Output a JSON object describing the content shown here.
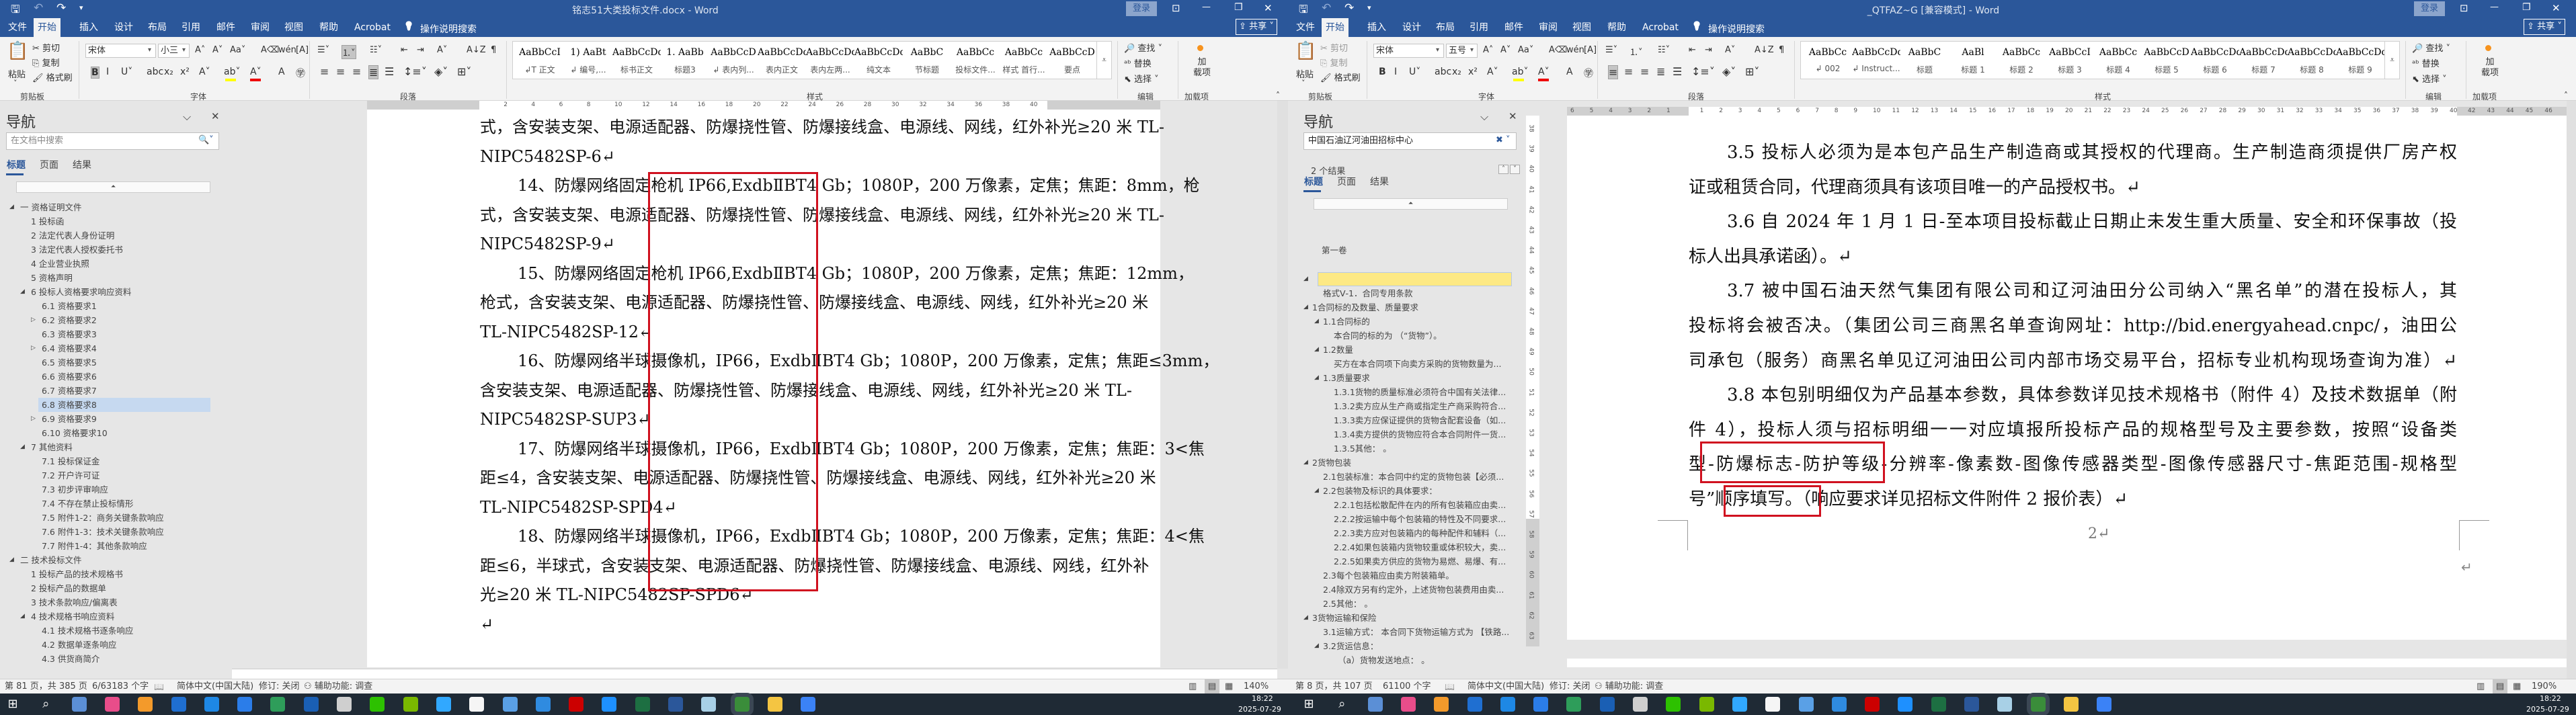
{
  "windows": [
    {
      "id": "left",
      "title": "铭志51大类投标文件.docx - Word",
      "login": "登录",
      "share": "共享",
      "tabs": [
        "文件",
        "开始",
        "插入",
        "设计",
        "布局",
        "引用",
        "邮件",
        "审阅",
        "视图",
        "帮助",
        "Acrobat"
      ],
      "active_tab": 1,
      "tell_me": "操作说明搜索",
      "clipboard": {
        "paste": "粘贴",
        "cut": "剪切",
        "copy": "复制",
        "format_painter": "格式刷",
        "group": "剪贴板",
        "cut_disabled": false
      },
      "font": {
        "name": "宋体",
        "size": "小三",
        "group": "字体"
      },
      "paragraph": {
        "group": "段落"
      },
      "styles": {
        "group": "样式",
        "items": [
          {
            "preview": "AaBbCcI",
            "label": "↲T 正文"
          },
          {
            "preview": "1) AaBt",
            "label": "↲ 编号,..."
          },
          {
            "preview": "AaBbCcDdI",
            "label": "标书正文"
          },
          {
            "preview": "1. AaBb",
            "label": "标题3"
          },
          {
            "preview": "AaBbCcD",
            "label": "↲ 表内列..."
          },
          {
            "preview": "AaBbCcDdI",
            "label": "表内正文"
          },
          {
            "preview": "AaBbCcDdEe",
            "label": "表内左两..."
          },
          {
            "preview": "AaBbCcDdI",
            "label": "纯文本"
          },
          {
            "preview": "AaBbC",
            "label": "节标题"
          },
          {
            "preview": "AaBbCc",
            "label": "投标文件..."
          },
          {
            "preview": "AaBbCc",
            "label": "样式 首行..."
          },
          {
            "preview": "AaBbCcD",
            "label": "要点"
          }
        ]
      },
      "editing": {
        "find": "查找",
        "replace": "替换",
        "select": "选择",
        "group": "编辑"
      },
      "addins": {
        "label": "加载项",
        "button": "加\n载项"
      },
      "nav": {
        "title": "导航",
        "search_placeholder": "在文档中搜索",
        "search_value": "",
        "results": "",
        "tabs": [
          "标题",
          "页面",
          "结果"
        ],
        "items": [
          {
            "lvl": 0,
            "exp": "open",
            "text": "一 资格证明文件"
          },
          {
            "lvl": 1,
            "text": "1 投标函"
          },
          {
            "lvl": 1,
            "text": "2 法定代表人身份证明"
          },
          {
            "lvl": 1,
            "text": "3 法定代表人授权委托书"
          },
          {
            "lvl": 1,
            "text": "4 企业营业执照"
          },
          {
            "lvl": 1,
            "text": "5 资格声明"
          },
          {
            "lvl": 1,
            "exp": "open",
            "text": "6 投标人资格要求响应资料"
          },
          {
            "lvl": 2,
            "text": "6.1 资格要求1"
          },
          {
            "lvl": 2,
            "exp": "closed",
            "text": "6.2 资格要求2"
          },
          {
            "lvl": 2,
            "text": "6.3 资格要求3"
          },
          {
            "lvl": 2,
            "exp": "closed",
            "text": "6.4 资格要求4"
          },
          {
            "lvl": 2,
            "text": "6.5 资格要求5"
          },
          {
            "lvl": 2,
            "text": "6.6 资格要求6"
          },
          {
            "lvl": 2,
            "text": "6.7 资格要求7"
          },
          {
            "lvl": 2,
            "sel": true,
            "text": "6.8 资格要求8"
          },
          {
            "lvl": 2,
            "exp": "closed",
            "text": "6.9 资格要求9"
          },
          {
            "lvl": 2,
            "text": "6.10 资格要求10"
          },
          {
            "lvl": 1,
            "exp": "open",
            "text": "7 其他资料"
          },
          {
            "lvl": 2,
            "text": "7.1 投标保证金"
          },
          {
            "lvl": 2,
            "text": "7.2 开户许可证"
          },
          {
            "lvl": 2,
            "text": "7.3 初步评审响应"
          },
          {
            "lvl": 2,
            "text": "7.4 不存在禁止投标情形"
          },
          {
            "lvl": 2,
            "text": "7.5 附件1-2：商务关键条款响应"
          },
          {
            "lvl": 2,
            "text": "7.6 附件1-3：技术关键条款响应"
          },
          {
            "lvl": 2,
            "text": "7.7 附件1-4：其他条款响应"
          },
          {
            "lvl": 0,
            "exp": "open",
            "text": "二 技术投标文件"
          },
          {
            "lvl": 1,
            "text": "1 投标产品的技术规格书"
          },
          {
            "lvl": 1,
            "text": "2 投标产品的数据单"
          },
          {
            "lvl": 1,
            "text": "3 技术条款响应/偏离表"
          },
          {
            "lvl": 1,
            "exp": "open",
            "text": "4 技术规格书响应资料"
          },
          {
            "lvl": 2,
            "text": "4.1 技术规格书逐条响应"
          },
          {
            "lvl": 2,
            "text": "4.2 数据单逐条响应"
          },
          {
            "lvl": 2,
            "text": "4.3 供货商简介"
          }
        ]
      },
      "ruler": {
        "labels": [
          2,
          4,
          6,
          8,
          10,
          12,
          14,
          16,
          18,
          20,
          22,
          24,
          26,
          28,
          30,
          32,
          34,
          36,
          38,
          40
        ]
      },
      "document": {
        "lines": [
          {
            "t": "式，含安装支架、电源适配器、防爆挠性管、防爆接线盒、电源线、网线，红外补光≥20 米 TL-",
            "full": true
          },
          {
            "t": "NIPC5482SP-6↵"
          },
          {
            "t": "14、防爆网络固定枪机  IP66,ExdbⅡBT4 Gb；1080P，200 万像素，定焦；焦距：8mm，枪",
            "full": true,
            "indent": true
          },
          {
            "t": "式，含安装支架、电源适配器、防爆挠性管、防爆接线盒、电源线、网线，红外补光≥20 米 TL-",
            "full": true
          },
          {
            "t": "NIPC5482SP-9↵"
          },
          {
            "t": "15、防爆网络固定枪机  IP66,ExdbⅡBT4  Gb；1080P，200 万像素，定焦；焦距：12mm，",
            "full": true,
            "indent": true
          },
          {
            "t": "枪式，含安装支架、电源适配器、防爆挠性管、防爆接线盒、电源线、网线，红外补光≥20 米",
            "full": true
          },
          {
            "t": "TL-NIPC5482SP-12↵"
          },
          {
            "t": "16、防爆网络半球摄像机，IP66，ExdbⅡBT4 Gb；1080P，200 万像素，定焦；焦距≤3mm，",
            "full": true,
            "indent": true
          },
          {
            "t": "含安装支架、电源适配器、防爆挠性管、防爆接线盒、电源线、网线，红外补光≥20 米  TL-",
            "full": true
          },
          {
            "t": "NIPC5482SP-SUP3↵"
          },
          {
            "t": "17、防爆网络半球摄像机，IP66，ExdbⅡBT4 Gb；1080P，200 万像素，定焦；焦距：3<焦",
            "full": true,
            "indent": true
          },
          {
            "t": "距≤4，含安装支架、电源适配器、防爆挠性管、防爆接线盒、电源线、网线，红外补光≥20 米",
            "full": true
          },
          {
            "t": "TL-NIPC5482SP-SPD4↵"
          },
          {
            "t": "18、防爆网络半球摄像机，IP66，ExdbⅡBT4 Gb；1080P，200 万像素，定焦；焦距：4<焦",
            "full": true,
            "indent": true
          },
          {
            "t": "距≤6，半球式，含安装支架、电源适配器、防爆挠性管、防爆接线盒、电源线、网线，红外补",
            "full": true
          },
          {
            "t": "光≥20 米 TL-NIPC5482SP-SPD6↵"
          },
          {
            "t": "↵"
          }
        ],
        "footer_page": ""
      },
      "status": {
        "page": "第 81 页，共 385 页",
        "words": "6/63183 个字",
        "lang": "简体中文(中国大陆)",
        "track": "修订: 关闭",
        "access": "辅助功能: 调查",
        "zoom": "140%"
      },
      "clock": {
        "time": "18:22",
        "date": "2025-07-29"
      }
    },
    {
      "id": "right",
      "title": "_QTFAZ~G [兼容模式] - Word",
      "login": "登录",
      "share": "共享",
      "tabs": [
        "文件",
        "开始",
        "插入",
        "设计",
        "布局",
        "引用",
        "邮件",
        "审阅",
        "视图",
        "帮助",
        "Acrobat"
      ],
      "active_tab": 1,
      "tell_me": "操作说明搜索",
      "clipboard": {
        "paste": "粘贴",
        "cut": "剪切",
        "copy": "复制",
        "format_painter": "格式刷",
        "group": "剪贴板",
        "cut_disabled": true
      },
      "font": {
        "name": "宋体",
        "size": "五号",
        "group": "字体"
      },
      "paragraph": {
        "group": "段落"
      },
      "styles": {
        "group": "样式",
        "items": [
          {
            "preview": "AaBbCc",
            "label": "↲ 002"
          },
          {
            "preview": "AaBbCcDdE",
            "label": "↲ Instruct..."
          },
          {
            "preview": "AaBbC",
            "label": "标题"
          },
          {
            "preview": "AaBl",
            "label": "标题 1"
          },
          {
            "preview": "AaBbCc",
            "label": "标题 2"
          },
          {
            "preview": "AaBbCcI",
            "label": "标题 3"
          },
          {
            "preview": "AaBbCc",
            "label": "标题 4"
          },
          {
            "preview": "AaBbCcD",
            "label": "标题 5"
          },
          {
            "preview": "AaBbCcDd",
            "label": "标题 6"
          },
          {
            "preview": "AaBbCcDd",
            "label": "标题 7"
          },
          {
            "preview": "AaBbCcDd",
            "label": "标题 8"
          },
          {
            "preview": "AaBbCcDd",
            "label": "标题 9"
          }
        ]
      },
      "editing": {
        "find": "查找",
        "replace": "替换",
        "select": "选择",
        "group": "编辑"
      },
      "addins": {
        "label": "加载项",
        "button": "加\n载项"
      },
      "nav": {
        "title": "导航",
        "search_placeholder": "在文档中搜索",
        "search_value": "中国石油辽河油田招标中心",
        "results": "2 个结果",
        "tabs": [
          "标题",
          "页面",
          "结果"
        ],
        "pre_heading": "第一卷",
        "items": [
          {
            "lvl": 0,
            "exp": "open",
            "hl": true,
            "text": ""
          },
          {
            "lvl": 2,
            "text": "格式Ⅴ-1．合同专用条款"
          },
          {
            "lvl": 0,
            "exp": "open",
            "text": "1合同标的及数量、质量要求"
          },
          {
            "lvl": 1,
            "exp": "open",
            "text": "1.1合同标的"
          },
          {
            "lvl": 3,
            "text": "本合同的标的为  （“货物”）。"
          },
          {
            "lvl": 1,
            "exp": "open",
            "text": "1.2数量"
          },
          {
            "lvl": 3,
            "text": "买方在本合同项下向卖方采购的货物数量为..."
          },
          {
            "lvl": 1,
            "exp": "open",
            "text": "1.3质量要求"
          },
          {
            "lvl": 3,
            "text": "1.3.1货物的质量标准必须符合中国有关法律..."
          },
          {
            "lvl": 3,
            "text": "1.3.2卖方应从生产商或指定生产商采购符合..."
          },
          {
            "lvl": 3,
            "text": "1.3.3卖方应保证提供的货物含配套设备（如..."
          },
          {
            "lvl": 3,
            "text": "1.3.4卖方提供的货物应符合本合同附件一货..."
          },
          {
            "lvl": 3,
            "text": "1.3.5其他：  。"
          },
          {
            "lvl": 0,
            "exp": "open",
            "text": "2货物包装"
          },
          {
            "lvl": 2,
            "text": "2.1包装标准：本合同中约定的货物包装【必须..."
          },
          {
            "lvl": 1,
            "exp": "open",
            "text": "2.2包装物及标识的具体要求："
          },
          {
            "lvl": 3,
            "text": "2.2.1包括松散配件在内的所有包装箱应由卖..."
          },
          {
            "lvl": 3,
            "text": "2.2.2按运输中每个包装箱的特性及不同要求..."
          },
          {
            "lvl": 3,
            "text": "2.2.3卖方应对包装箱内的每种配件和辅料（..."
          },
          {
            "lvl": 3,
            "text": "2.2.4如果包装箱内货物较重或体积较大，卖..."
          },
          {
            "lvl": 3,
            "text": "2.2.5如果卖方供应的货物为易燃、易爆、有..."
          },
          {
            "lvl": 2,
            "text": "2.3每个包装箱应由卖方附装箱单。"
          },
          {
            "lvl": 2,
            "text": "2.4除双方另有约定外，上述货物包装费用由卖..."
          },
          {
            "lvl": 2,
            "text": "2.5其他：  。"
          },
          {
            "lvl": 0,
            "exp": "open",
            "text": "3货物运输和保险"
          },
          {
            "lvl": 2,
            "text": "3.1运输方式：  本合同下货物运输方式为 【铁路..."
          },
          {
            "lvl": 1,
            "exp": "open",
            "text": "3.2货运信息："
          },
          {
            "lvl": 4,
            "text": "（a）货物发送地点：    。"
          }
        ]
      },
      "ruler": {
        "left_labels": [
          6,
          5,
          4,
          3,
          2,
          1
        ],
        "labels": [
          1,
          2,
          3,
          4,
          5,
          6,
          7,
          8,
          9,
          10,
          11,
          12,
          13,
          14,
          15,
          16,
          17,
          18,
          19,
          20,
          21,
          22,
          23,
          24,
          25,
          26,
          27,
          28,
          29,
          30,
          31,
          32,
          33,
          34,
          35,
          36,
          37,
          38,
          39,
          40
        ],
        "right_labels": [
          42,
          43,
          44,
          45,
          46
        ]
      },
      "vruler": {
        "labels": [
          38,
          39,
          40,
          41,
          42,
          43,
          44,
          45,
          46,
          47,
          48,
          49,
          50,
          51,
          52,
          53,
          54,
          55,
          56,
          57,
          58,
          59,
          60,
          61,
          62,
          63
        ]
      },
      "document": {
        "lines": [
          {
            "t": "3.5 投标人必须为是本包产品生产制造商或其授权的代理商。生产制造商须提供厂房产权",
            "full": true,
            "indent": true
          },
          {
            "t": "证或租赁合同，代理商须具有该项目唯一的产品授权书。↵"
          },
          {
            "t": "3.6 自 2024 年 1 月 1 日-至本项目投标截止日期止未发生重大质量、安全和环保事故（投",
            "full": true,
            "indent": true
          },
          {
            "t": "标人出具承诺函）。↵"
          },
          {
            "t": "3.7 被中国石油天然气集团有限公司和辽河油田分公司纳入“黑名单”的潜在投标人，其",
            "full": true,
            "indent": true
          },
          {
            "t": "投标将会被否决。（集团公司三商黑名单查询网址：http://bid.energyahead.cnpc/，油田公",
            "full": true
          },
          {
            "t": "司承包（服务）商黑名单见辽河油田公司内部市场交易平台，招标专业机构现场查询为准）↵",
            "full": true
          },
          {
            "t": "3.8 本包别明细仅为产品基本参数，具体参数详见技术规格书（附件 4）及技术数据单（附",
            "full": true,
            "indent": true
          },
          {
            "t": "件 4），投标人须与招标明细一一对应填报所投标产品的规格型号及主要参数，按照“设备类",
            "full": true
          },
          {
            "t": "型-防爆标志-防护等级-分辨率-像素数-图像传感器类型-图像传感器尺寸-焦距范围-规格型",
            "full": true
          },
          {
            "t": "号”顺序填写。（响应要求详见招标文件附件 2 报价表）↵"
          }
        ],
        "footer_page": "2↵",
        "end_mark": "↵"
      },
      "status": {
        "page": "第 8 页，共 107 页",
        "words": "61100 个字",
        "lang": "简体中文(中国大陆)",
        "track": "修订: 关闭",
        "access": "辅助功能: 调查",
        "zoom": "190%"
      },
      "clock": {
        "time": "18:22",
        "date": "2025-07-29"
      }
    }
  ],
  "taskbar_icons": [
    "windows-start-icon",
    "search-icon",
    "calculator-icon",
    "color-wheel-app-icon",
    "camera-app-icon",
    "dots-app-icon",
    "blue-t-app-icon",
    "blue-ring-app-icon",
    "sync-arrows-app-icon",
    "ks-app-icon",
    "printer-app-icon",
    "wechat-icon",
    "pen-app-icon",
    "photoshop-icon",
    "qq-icon",
    "xin-app-icon",
    "q-map-app-icon",
    "acrobat-icon",
    "blue-circle-app-icon",
    "excel-icon",
    "word-icon",
    "notepad-glass-icon",
    "green-j-app-icon",
    "folder-icon",
    "blue-arrow-app-icon"
  ],
  "colors": {
    "brand": "#2b579a",
    "highlight_box": "#d0111f",
    "nav_selected": "#c6d9f0",
    "search_hit": "#fde984",
    "taskbar": "#1f2a35"
  }
}
